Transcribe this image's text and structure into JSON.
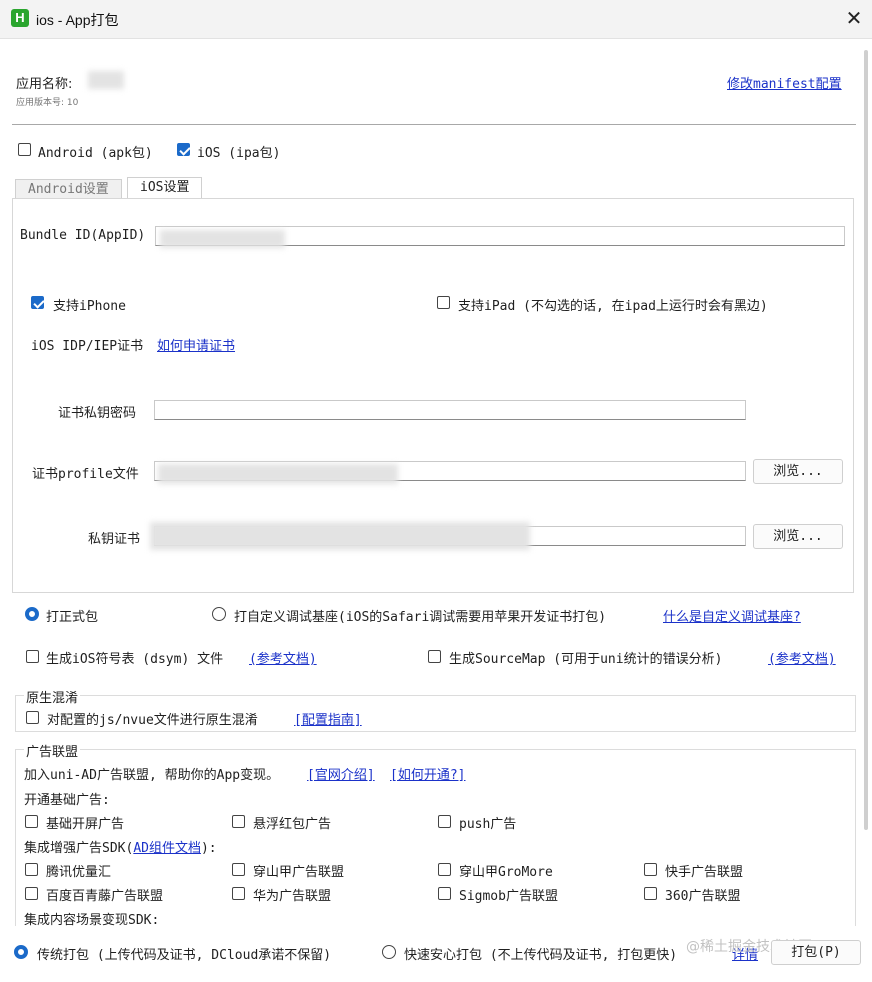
{
  "window": {
    "title": "ios - App打包",
    "icon": "H"
  },
  "app_info": {
    "name_label": "应用名称:",
    "version_label": "应用版本号: 10",
    "manifest_link": "修改manifest配置"
  },
  "platforms": {
    "android": "Android (apk包)",
    "ios": "iOS (ipa包)"
  },
  "tabs": {
    "android": "Android设置",
    "ios": "iOS设置"
  },
  "ios_settings": {
    "bundle_id_label": "Bundle ID(AppID)",
    "support_iphone": "支持iPhone",
    "support_ipad": "支持iPad (不勾选的话, 在ipad上运行时会有黑边)",
    "cert_label": "iOS IDP/IEP证书",
    "cert_link": "如何申请证书",
    "key_password_label": "证书私钥密码",
    "profile_label": "证书profile文件",
    "private_key_label": "私钥证书",
    "browse": "浏览..."
  },
  "build_type": {
    "formal": "打正式包",
    "custom_base": "打自定义调试基座(iOS的Safari调试需要用苹果开发证书打包)",
    "custom_base_link": "什么是自定义调试基座?"
  },
  "dsym": {
    "label": "生成iOS符号表 (dsym) 文件",
    "doc_link": "(参考文档)"
  },
  "sourcemap": {
    "label": "生成SourceMap (可用于uni统计的错误分析)",
    "doc_link": "(参考文档)"
  },
  "native_obfuscation": {
    "title": "原生混淆",
    "label": "对配置的js/nvue文件进行原生混淆",
    "guide_link": "[配置指南]"
  },
  "ads": {
    "title": "广告联盟",
    "intro": "加入uni-AD广告联盟, 帮助你的App变现。",
    "intro_link1": "[官网介绍]",
    "intro_link2": "[如何开通?]",
    "basic_title": "开通基础广告:",
    "basic": [
      "基础开屏广告",
      "悬浮红包广告",
      "push广告"
    ],
    "enhanced_title_prefix": "集成增强广告SDK(",
    "enhanced_title_link": "AD组件文档",
    "enhanced_title_suffix": "):",
    "enhanced": [
      "腾讯优量汇",
      "穿山甲广告联盟",
      "穿山甲GroMore",
      "快手广告联盟",
      "百度百青藤广告联盟",
      "华为广告联盟",
      "Sigmob广告联盟",
      "360广告联盟"
    ],
    "content_title": "集成内容场景变现SDK:"
  },
  "footer": {
    "traditional": "传统打包 (上传代码及证书, DCloud承诺不保留)",
    "fast": "快速安心打包 (不上传代码及证书, 打包更快)",
    "details_link": "详情",
    "pack_button": "打包(P)"
  },
  "watermark": "@稀土掘金技术社区",
  "colors": {
    "accent": "#1b6ac9",
    "link": "#1b32c9"
  }
}
